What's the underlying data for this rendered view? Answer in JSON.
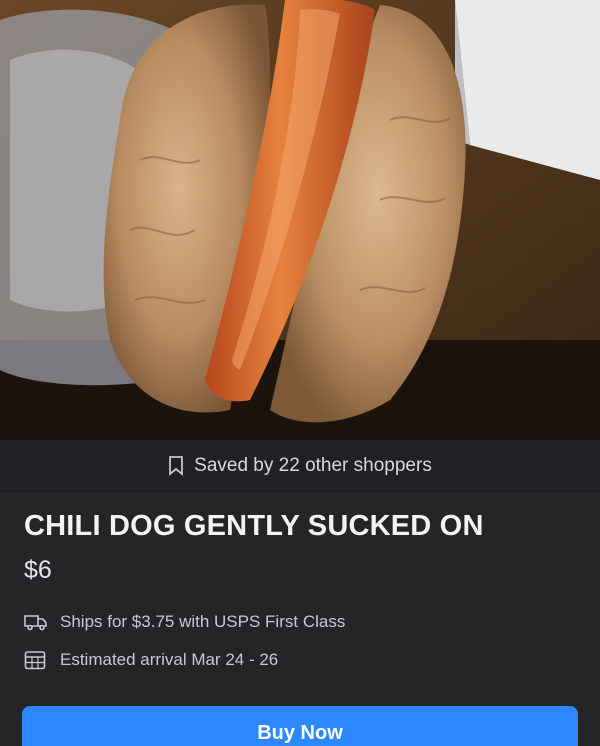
{
  "saved": {
    "text": "Saved by 22 other shoppers",
    "icon": "bookmark-icon"
  },
  "listing": {
    "title": "CHILI DOG GENTLY SUCKED ON",
    "price": "$6"
  },
  "shipping": {
    "text": "Ships for $3.75 with USPS First Class",
    "icon": "truck-icon"
  },
  "arrival": {
    "text": "Estimated arrival Mar 24 - 26",
    "icon": "calendar-icon"
  },
  "buy_button": {
    "label": "Buy Now"
  },
  "colors": {
    "background": "#242526",
    "accent": "#2d88ff",
    "text": "#e4e6eb"
  }
}
